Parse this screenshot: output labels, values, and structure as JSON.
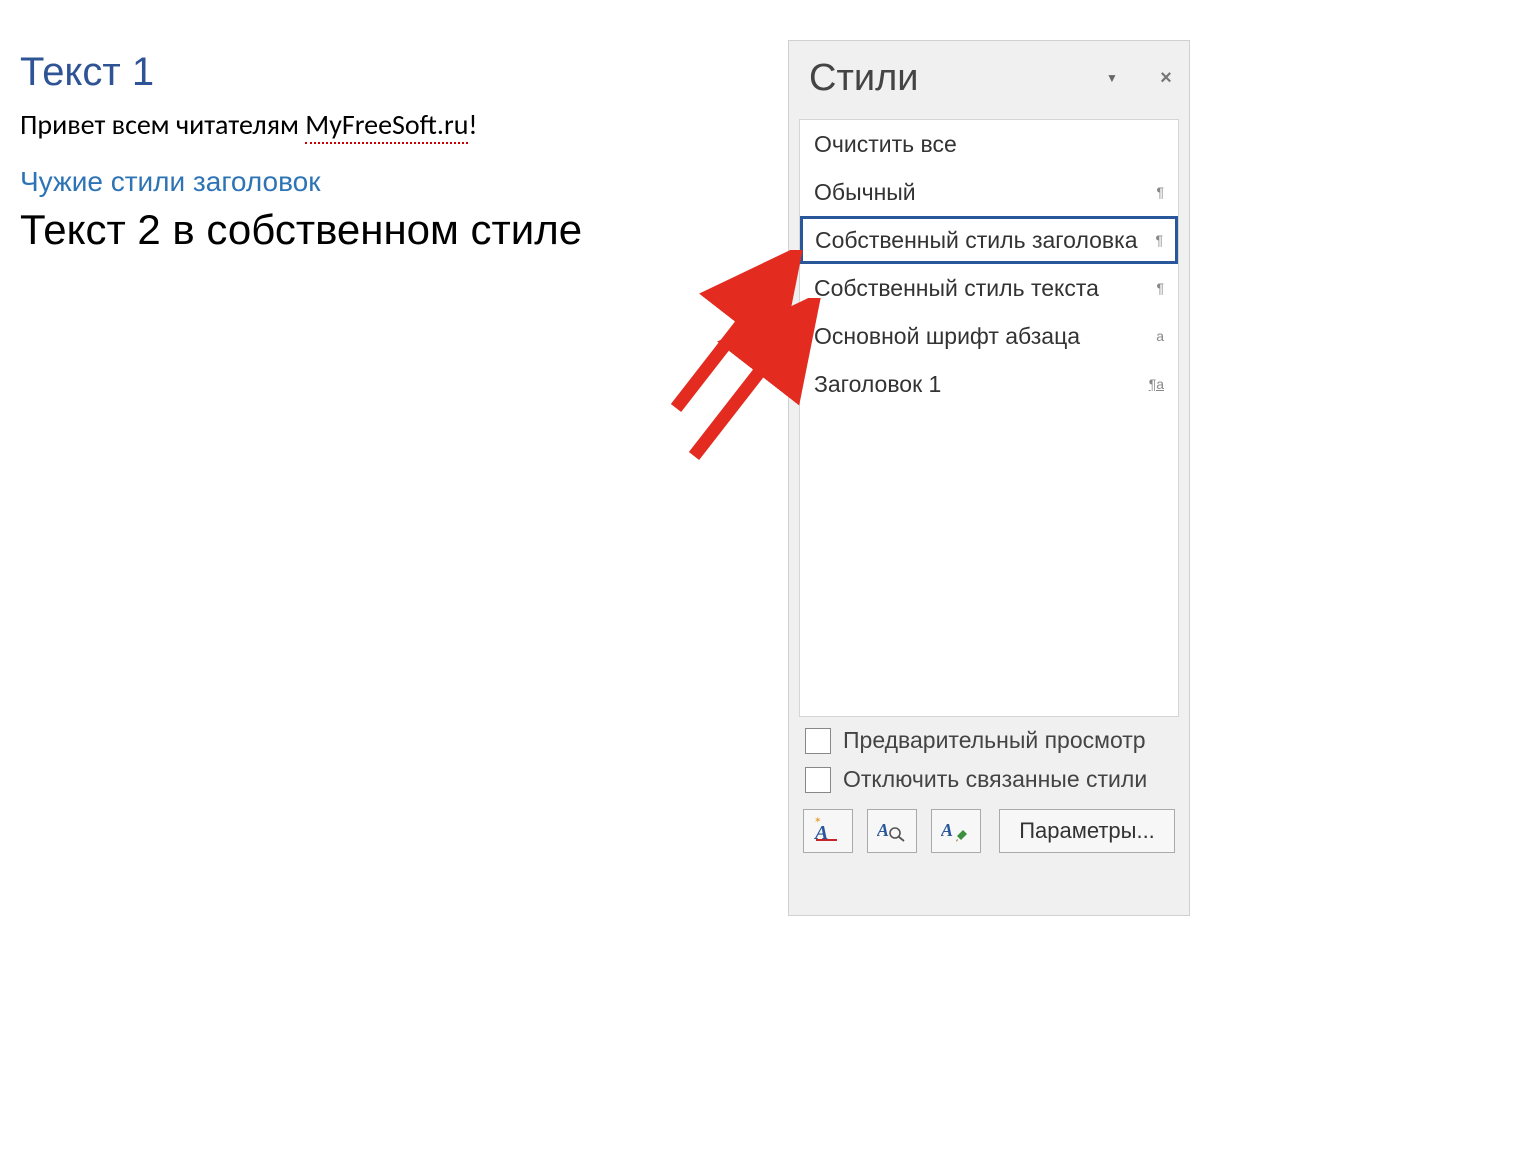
{
  "document": {
    "heading1": "Текст 1",
    "body_prefix": "Привет всем читателям ",
    "body_spell": "MyFreeSoft.ru",
    "body_suffix": "!",
    "subheading": "Чужие стили заголовок",
    "custom_text": "Текст 2 в собственном стиле"
  },
  "pane": {
    "title": "Стили",
    "items": [
      {
        "label": "Очистить все",
        "marker": "",
        "selected": false
      },
      {
        "label": "Обычный",
        "marker": "¶",
        "selected": false
      },
      {
        "label": "Собственный стиль заголовка",
        "marker": "¶",
        "selected": true
      },
      {
        "label": "Собственный стиль текста",
        "marker": "¶",
        "selected": false
      },
      {
        "label": "Основной шрифт абзаца",
        "marker": "a",
        "selected": false
      },
      {
        "label": "Заголовок 1",
        "marker": "¶a",
        "marker_underline": true,
        "selected": false
      }
    ],
    "check_preview": "Предварительный просмотр",
    "check_disable_linked": "Отключить связанные стили",
    "options_button": "Параметры..."
  },
  "colors": {
    "accent": "#2A579A",
    "heading": "#2E5496",
    "subheading": "#2E74B5",
    "arrow": "#E32B1F"
  }
}
